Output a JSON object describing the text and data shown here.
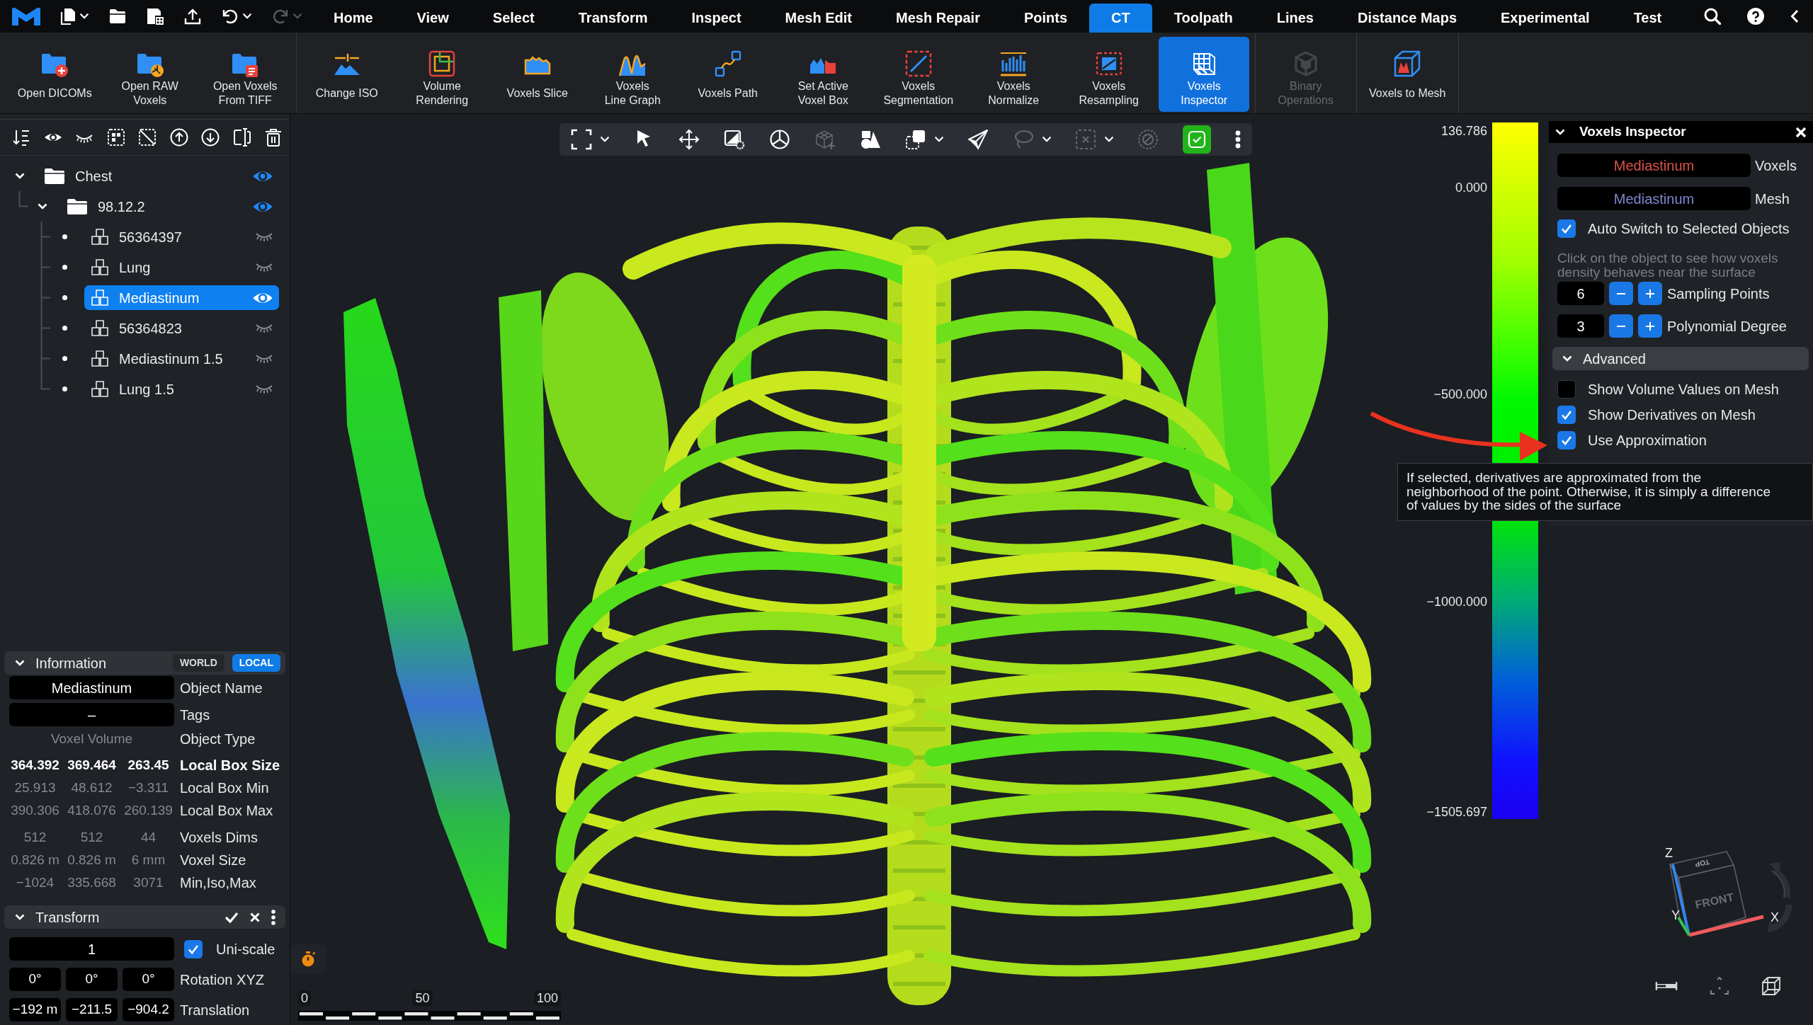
{
  "menubar": {
    "quick_tools": [
      {
        "dropdown": true,
        "disabled": false
      },
      {
        "dropdown": false,
        "disabled": false
      },
      {
        "dropdown": false,
        "disabled": false
      },
      {
        "dropdown": false,
        "disabled": false
      },
      {
        "dropdown": true,
        "disabled": false
      },
      {
        "dropdown": true,
        "disabled": true
      }
    ],
    "tabs": [
      {
        "label": "Home",
        "selected": false
      },
      {
        "label": "View",
        "selected": false
      },
      {
        "label": "Select",
        "selected": false
      },
      {
        "label": "Transform",
        "selected": false
      },
      {
        "label": "Inspect",
        "selected": false
      },
      {
        "label": "Mesh Edit",
        "selected": false
      },
      {
        "label": "Mesh Repair",
        "selected": false
      },
      {
        "label": "Points",
        "selected": false
      },
      {
        "label": "CT",
        "selected": true
      },
      {
        "label": "Toolpath",
        "selected": false
      },
      {
        "label": "Lines",
        "selected": false
      },
      {
        "label": "Distance Maps",
        "selected": false
      },
      {
        "label": "Experimental",
        "selected": false
      },
      {
        "label": "Test",
        "selected": false
      }
    ]
  },
  "ribbon": {
    "groups": [
      {
        "tools": [
          {
            "label": "Open DICOMs",
            "selected": false,
            "disabled": false
          },
          {
            "label": "Open RAW\nVoxels",
            "selected": false,
            "disabled": false
          },
          {
            "label": "Open Voxels\nFrom TIFF",
            "selected": false,
            "disabled": false
          }
        ]
      },
      {
        "tools": [
          {
            "label": "Change ISO",
            "selected": false,
            "disabled": false
          },
          {
            "label": "Volume\nRendering",
            "selected": false,
            "disabled": false
          },
          {
            "label": "Voxels Slice",
            "selected": false,
            "disabled": false
          },
          {
            "label": "Voxels\nLine Graph",
            "selected": false,
            "disabled": false
          },
          {
            "label": "Voxels Path",
            "selected": false,
            "disabled": false
          },
          {
            "label": "Set Active\nVoxel Box",
            "selected": false,
            "disabled": false
          },
          {
            "label": "Voxels\nSegmentation",
            "selected": false,
            "disabled": false
          },
          {
            "label": "Voxels\nNormalize",
            "selected": false,
            "disabled": false
          },
          {
            "label": "Voxels\nResampling",
            "selected": false,
            "disabled": false
          },
          {
            "label": "Voxels\nInspector",
            "selected": true,
            "disabled": false
          }
        ]
      },
      {
        "tools": [
          {
            "label": "Binary\nOperations",
            "selected": false,
            "disabled": true
          }
        ]
      },
      {
        "tools": [
          {
            "label": "Voxels to Mesh",
            "selected": false,
            "disabled": false
          }
        ]
      }
    ]
  },
  "scene_tree": [
    {
      "label": "Chest",
      "kind": "folder",
      "expanded": true,
      "visible": true,
      "selected": false,
      "children": [
        {
          "label": "98.12.2",
          "kind": "folder",
          "expanded": true,
          "visible": true,
          "selected": false,
          "children": [
            {
              "label": "56364397",
              "kind": "object",
              "visible": false,
              "selected": false
            },
            {
              "label": "Lung",
              "kind": "object",
              "visible": false,
              "selected": false
            },
            {
              "label": "Mediastinum",
              "kind": "object",
              "visible": true,
              "selected": true
            },
            {
              "label": "56364823",
              "kind": "object",
              "visible": false,
              "selected": false
            },
            {
              "label": "Mediastinum 1.5",
              "kind": "object",
              "visible": false,
              "selected": false
            },
            {
              "label": "Lung 1.5",
              "kind": "object",
              "visible": false,
              "selected": false
            }
          ]
        }
      ]
    }
  ],
  "information": {
    "title": "Information",
    "expanded": true,
    "modes": [
      {
        "label": "WORLD",
        "selected": false
      },
      {
        "label": "LOCAL",
        "selected": true
      }
    ],
    "rows": [
      {
        "kind": "input",
        "values": [
          "Mediastinum"
        ],
        "label": "Object Name"
      },
      {
        "kind": "input",
        "values": [
          "–"
        ],
        "label": "Tags"
      },
      {
        "kind": "readout",
        "values": [
          "Voxel Volume"
        ],
        "label": "Object Type"
      },
      {
        "kind": "emphasis",
        "values": [
          "364.392",
          "369.464",
          "263.45"
        ],
        "label": "Local Box Size"
      },
      {
        "kind": "readout",
        "values": [
          "25.913",
          "48.612",
          "−3.311"
        ],
        "label": "Local Box Min"
      },
      {
        "kind": "readout",
        "values": [
          "390.306",
          "418.076",
          "260.139"
        ],
        "label": "Local Box Max"
      },
      {
        "kind": "readout",
        "values": [
          "512",
          "512",
          "44"
        ],
        "label": "Voxels Dims"
      },
      {
        "kind": "readout",
        "values": [
          "0.826 m",
          "0.826 m",
          "6 mm"
        ],
        "label": "Voxel Size"
      },
      {
        "kind": "readout",
        "values": [
          "−1024",
          "335.668",
          "3071"
        ],
        "label": "Min,Iso,Max"
      }
    ]
  },
  "transform": {
    "title": "Transform",
    "expanded": true,
    "rows": [
      {
        "kind": "input",
        "values": [
          "1"
        ],
        "toggle": {
          "label": "Uni-scale",
          "checked": true
        }
      },
      {
        "kind": "input",
        "values": [
          "0°",
          "0°",
          "0°"
        ],
        "label": "Rotation XYZ"
      },
      {
        "kind": "input",
        "values": [
          "−192 m",
          "−211.5",
          "−904.2"
        ],
        "label": "Translation"
      }
    ]
  },
  "viewport": {
    "toolbar": [
      {
        "dropdown": true,
        "disabled": false,
        "active": false
      },
      {
        "dropdown": false,
        "disabled": false,
        "active": false
      },
      {
        "dropdown": false,
        "disabled": false,
        "active": false
      },
      {
        "dropdown": false,
        "disabled": false,
        "active": false
      },
      {
        "dropdown": false,
        "disabled": false,
        "active": false
      },
      {
        "dropdown": false,
        "disabled": true,
        "active": false
      },
      {
        "dropdown": false,
        "disabled": false,
        "active": false
      },
      {
        "dropdown": true,
        "disabled": false,
        "active": false
      },
      {
        "dropdown": false,
        "disabled": false,
        "active": false
      },
      {
        "dropdown": true,
        "disabled": true,
        "active": false
      },
      {
        "dropdown": true,
        "disabled": true,
        "active": false
      },
      {
        "dropdown": false,
        "disabled": true,
        "active": false
      },
      {
        "dropdown": false,
        "disabled": false,
        "active": true
      },
      {
        "dropdown": false,
        "disabled": false,
        "active": false
      }
    ],
    "color_scale": {
      "labels": [
        "136.786",
        "0.000",
        "−500.000",
        "−1000.000",
        "−1505.697"
      ]
    },
    "scale_bar": {
      "labels": [
        "0",
        "50",
        "100"
      ]
    },
    "view_cube": {
      "face": "FRONT",
      "top_face": "TOP",
      "axes": [
        "Z",
        "Y",
        "X"
      ]
    }
  },
  "inspector": {
    "title": "Voxels Inspector",
    "expanded": true,
    "sources": [
      {
        "kind": "voxels",
        "value": "Mediastinum",
        "label": "Voxels"
      },
      {
        "kind": "mesh",
        "value": "Mediastinum",
        "label": "Mesh"
      }
    ],
    "auto_switch": {
      "label": "Auto Switch to Selected Objects",
      "checked": true
    },
    "hint": "Click on the object to see how voxels\ndensity behaves near the surface",
    "parameters": [
      {
        "value": "6",
        "label": "Sampling Points"
      },
      {
        "value": "3",
        "label": "Polynomial Degree"
      }
    ],
    "advanced": {
      "title": "Advanced",
      "expanded": true,
      "options": [
        {
          "label": "Show Volume Values on Mesh",
          "checked": false
        },
        {
          "label": "Show Derivatives on Mesh",
          "checked": true
        },
        {
          "label": "Use Approximation",
          "checked": true
        }
      ]
    }
  },
  "tooltip": {
    "text": "If selected, derivatives are approximated from the\nneighborhood of the point. Otherwise, it is simply a difference\nof values by the sides of the surface"
  }
}
